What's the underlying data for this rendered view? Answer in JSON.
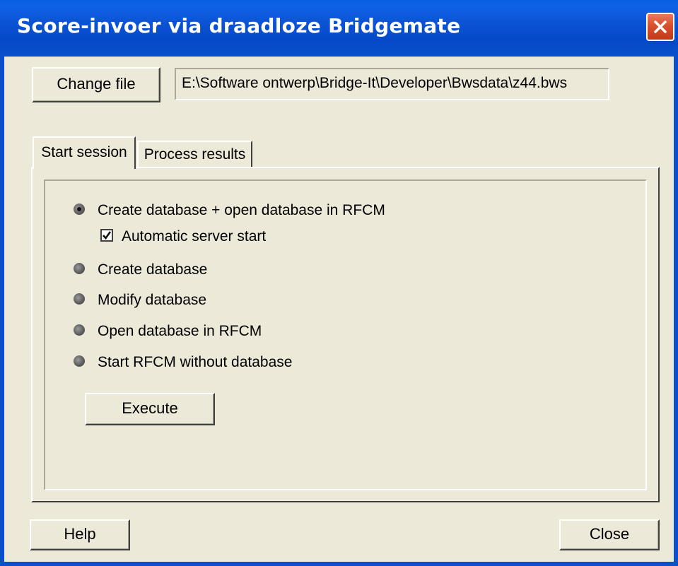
{
  "window": {
    "title": "Score-invoer via draadloze Bridgemate"
  },
  "file": {
    "change_label": "Change file",
    "path": "E:\\Software ontwerp\\Bridge-It\\Developer\\Bwsdata\\z44.bws"
  },
  "tabs": [
    {
      "label": "Start session",
      "active": true
    },
    {
      "label": "Process results",
      "active": false
    }
  ],
  "options": [
    {
      "label": "Create database + open database in RFCM",
      "selected": true
    },
    {
      "label": "Create database",
      "selected": false
    },
    {
      "label": "Modify database",
      "selected": false
    },
    {
      "label": "Open database in RFCM",
      "selected": false
    },
    {
      "label": "Start RFCM without database",
      "selected": false
    }
  ],
  "auto_start": {
    "label": "Automatic server start",
    "checked": true
  },
  "buttons": {
    "execute": "Execute",
    "help": "Help",
    "close": "Close"
  }
}
